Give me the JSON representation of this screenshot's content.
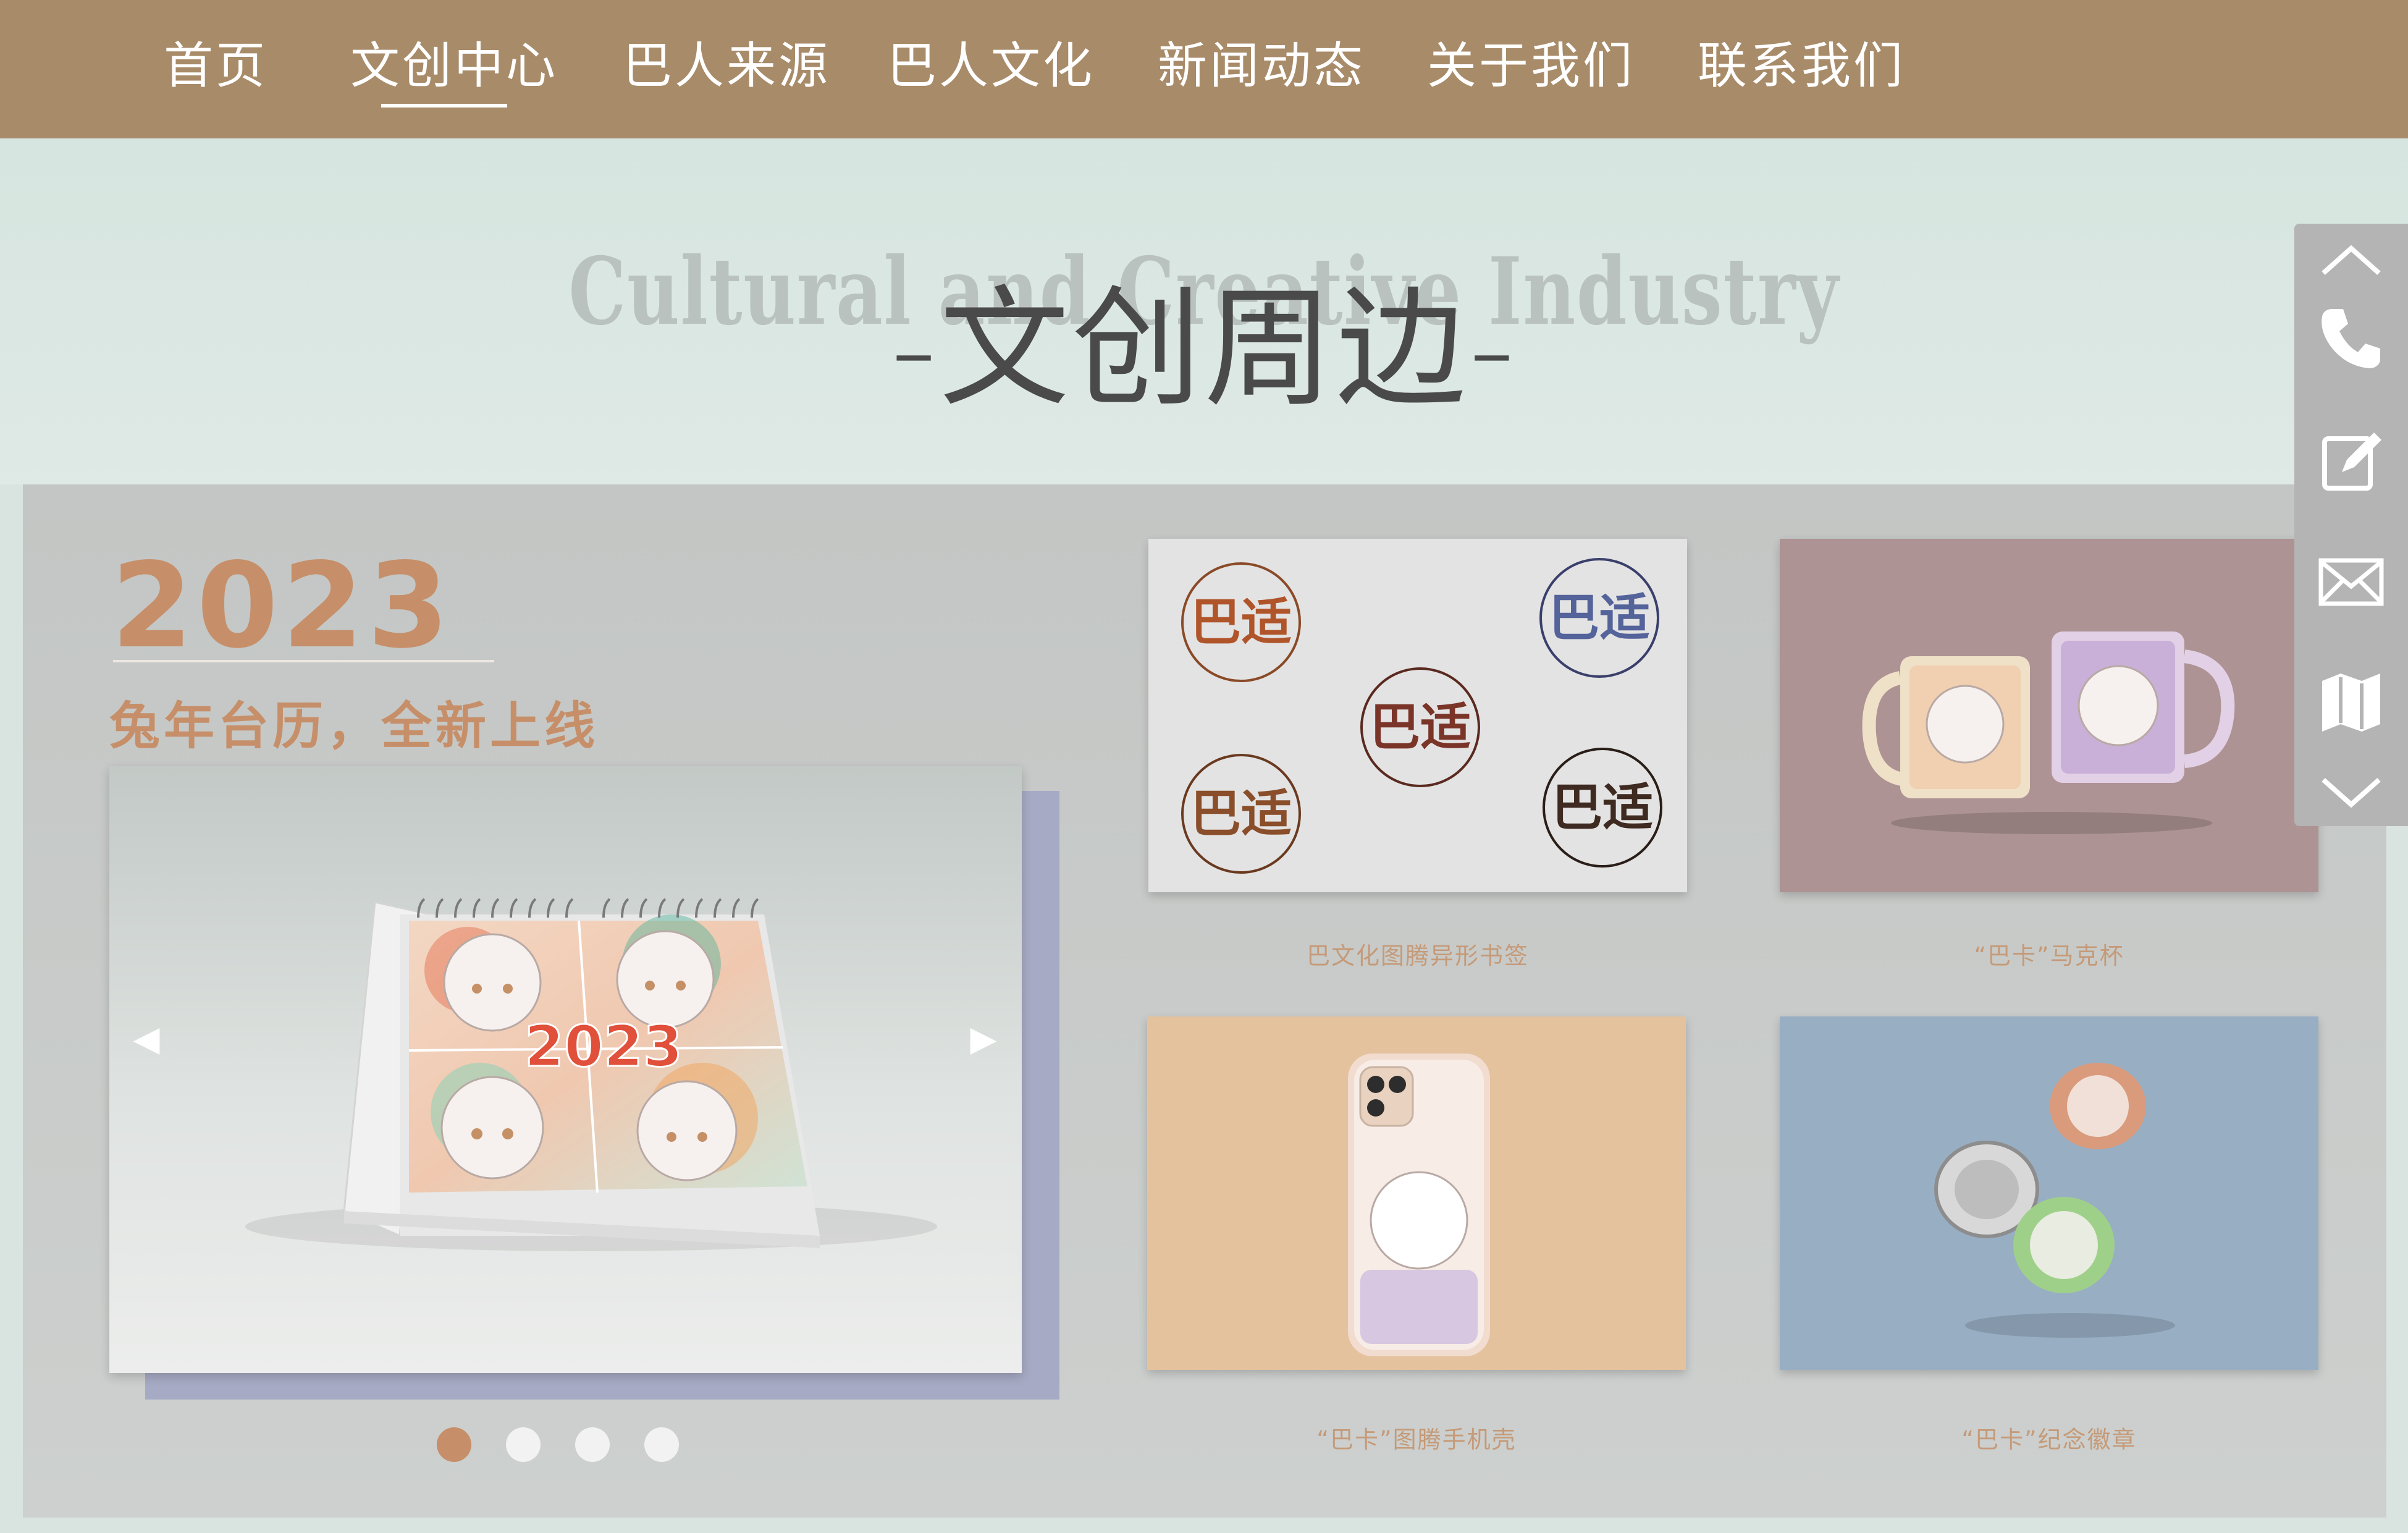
{
  "nav": {
    "items": [
      {
        "label": "首页"
      },
      {
        "label": "文创中心"
      },
      {
        "label": "巴人来源"
      },
      {
        "label": "巴人文化"
      },
      {
        "label": "新闻动态"
      },
      {
        "label": "关于我们"
      },
      {
        "label": "联系我们"
      }
    ],
    "active_index": 1
  },
  "hero": {
    "title_en": "Cultural and Creative Industry",
    "title_cn": "-文创周边-"
  },
  "feature": {
    "year": "2023",
    "tagline": "兔年台历，全新上线",
    "calendar_digits": "2023",
    "slide_count": 4,
    "active_slide": 1
  },
  "products": [
    {
      "caption": "巴文化图腾异形书签",
      "logo_text": "巴适"
    },
    {
      "caption": "“巴卡”马克杯"
    },
    {
      "caption": "“巴卡”图腾手机壳"
    },
    {
      "caption": "“巴卡”纪念徽章"
    }
  ],
  "sidebar": {
    "icons": [
      "chevron-up-icon",
      "phone-icon",
      "edit-icon",
      "mail-icon",
      "map-icon",
      "chevron-down-icon"
    ]
  },
  "colors": {
    "nav_bg": "#a88b69",
    "accent": "#c68f69",
    "hero_bg": "#d9e4e1",
    "panel_bg": "#c5c8c6"
  }
}
